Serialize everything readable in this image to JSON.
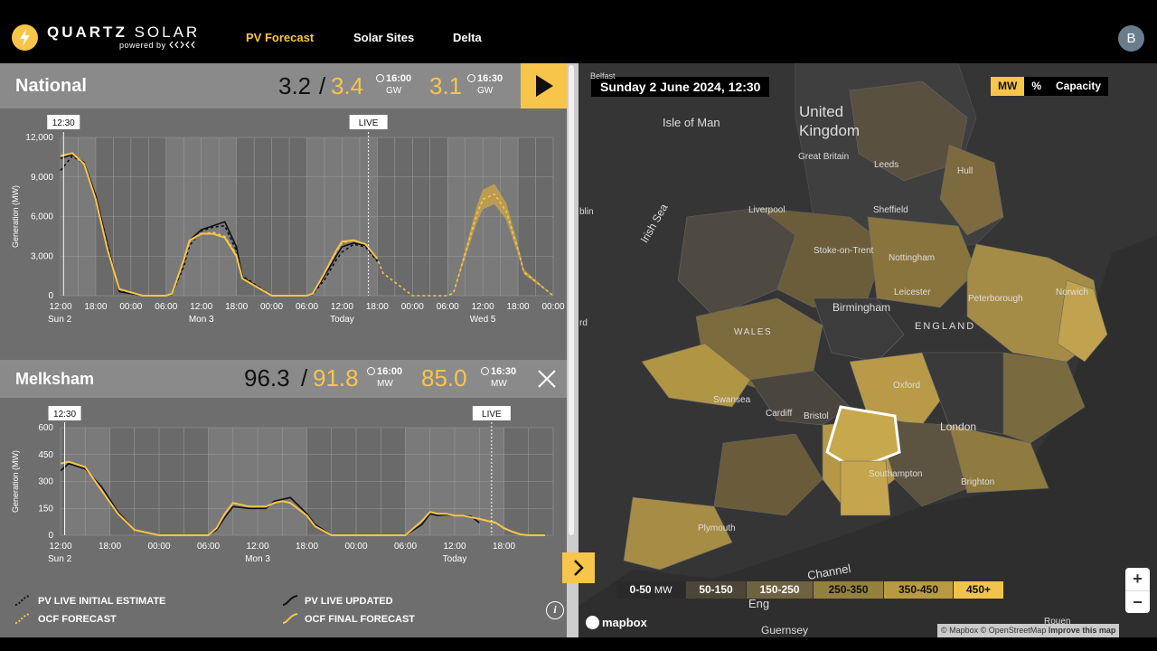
{
  "header": {
    "brand_bold": "QUARTZ",
    "brand_light": "SOLAR",
    "powered_by": "powered by",
    "nav": [
      "PV Forecast",
      "Solar Sites",
      "Delta"
    ],
    "active_nav": "PV Forecast",
    "avatar_initial": "B"
  },
  "national": {
    "title": "National",
    "actual": "3.2",
    "sep": "/",
    "forecast": "3.4",
    "forecast_time": "16:00",
    "forecast_unit": "GW",
    "next": "3.1",
    "next_time": "16:30",
    "next_unit": "GW",
    "marker_label": "12:30",
    "live_label": "LIVE",
    "ylabel": "Generation (MW)"
  },
  "melksham": {
    "title": "Melksham",
    "actual": "96.3",
    "sep": "/",
    "forecast": "91.8",
    "forecast_time": "16:00",
    "forecast_unit": "MW",
    "next": "85.0",
    "next_time": "16:30",
    "next_unit": "MW",
    "marker_label": "12:30",
    "live_label": "LIVE",
    "ylabel": "Generation (MW)"
  },
  "legend": {
    "initial": "PV LIVE INITIAL ESTIMATE",
    "updated": "PV LIVE UPDATED",
    "forecast": "OCF FORECAST",
    "final": "OCF FINAL FORECAST"
  },
  "map": {
    "date": "Sunday 2 June 2024, 12:30",
    "units": [
      "MW",
      "%",
      "Capacity"
    ],
    "active_unit": "MW",
    "labels": {
      "isle_of_man": "Isle of Man",
      "united_kingdom": "United Kingdom",
      "great_britain": "Great Britain",
      "leeds": "Leeds",
      "hull": "Hull",
      "liverpool": "Liverpool",
      "sheffield": "Sheffield",
      "irish_sea": "Irish Sea",
      "dublin": "blin",
      "belfast": "Belfast",
      "stoke": "Stoke-on-Trent",
      "nottingham": "Nottingham",
      "leicester": "Leicester",
      "peterborough": "Peterborough",
      "norwich": "Norwich",
      "birmingham": "Birmingham",
      "england": "ENGLAND",
      "wales": "WALES",
      "oxford": "Oxford",
      "swansea": "Swansea",
      "cardiff": "Cardiff",
      "bristol": "Bristol",
      "london": "London",
      "southampton": "Southampton",
      "brighton": "Brighton",
      "plymouth": "Plymouth",
      "channel": "Channel",
      "guernsey": "Guernsey",
      "rouen": "Rouen",
      "eng": "Eng",
      "rd": "rd"
    },
    "legend": [
      "0-50",
      "50-150",
      "150-250",
      "250-350",
      "350-450",
      "450+"
    ],
    "legend_unit": "MW",
    "zoom_in": "+",
    "zoom_out": "−",
    "mapbox": "mapbox",
    "attribution": "© Mapbox © OpenStreetMap",
    "improve": "Improve this map"
  },
  "chart_data": [
    {
      "type": "line",
      "name": "National",
      "ylabel": "Generation (MW)",
      "ylim": [
        0,
        12000
      ],
      "yticks": [
        "0",
        "3,000",
        "6,000",
        "9,000",
        "12,000"
      ],
      "x_tick_labels": [
        "12:00",
        "18:00",
        "00:00",
        "06:00",
        "12:00",
        "18:00",
        "00:00",
        "06:00",
        "12:00",
        "18:00",
        "00:00",
        "06:00",
        "12:00",
        "18:00",
        "00:00"
      ],
      "day_labels": [
        "Sun 2",
        "Mon 3",
        "Today",
        "Wed 5"
      ],
      "x_hours": [
        0,
        2,
        4,
        6,
        8,
        10,
        14,
        18,
        19,
        21,
        22,
        24,
        26,
        28,
        30,
        31,
        36,
        42,
        43,
        45,
        47,
        48,
        50,
        52,
        54,
        55,
        60,
        66,
        67,
        69,
        71,
        72,
        74,
        76,
        78,
        79,
        84
      ],
      "series": [
        {
          "name": "PV LIVE INITIAL ESTIMATE",
          "values": [
            9500,
            10600,
            10000,
            7500,
            3800,
            400,
            0,
            0,
            100,
            2200,
            3800,
            4900,
            5200,
            5300,
            3400,
            1500,
            0,
            0,
            100,
            1200,
            2700,
            3300,
            3900,
            3700,
            2600,
            null,
            null,
            null,
            null,
            null,
            null,
            null,
            null,
            null,
            null,
            null,
            null
          ]
        },
        {
          "name": "PV LIVE UPDATED",
          "values": [
            10400,
            10700,
            10100,
            7600,
            3900,
            300,
            0,
            0,
            100,
            2500,
            4200,
            5000,
            5300,
            5600,
            3700,
            1400,
            0,
            0,
            100,
            1500,
            3000,
            3700,
            4000,
            3800,
            2700,
            null,
            null,
            null,
            null,
            null,
            null,
            null,
            null,
            null,
            null,
            null,
            null
          ]
        },
        {
          "name": "OCF FORECAST",
          "values": [
            10600,
            10800,
            10000,
            7300,
            3600,
            500,
            0,
            0,
            150,
            2600,
            4100,
            4700,
            4800,
            4500,
            3100,
            1300,
            0,
            0,
            150,
            1700,
            3300,
            4000,
            4200,
            3900,
            2800,
            1700,
            0,
            0,
            200,
            3200,
            6200,
            7300,
            7700,
            6400,
            3500,
            1800,
            0
          ]
        },
        {
          "name": "OCF FINAL FORECAST",
          "values": [
            10600,
            10800,
            10000,
            7300,
            3500,
            500,
            0,
            0,
            150,
            2700,
            4200,
            4700,
            4700,
            4400,
            3000,
            1300,
            0,
            0,
            150,
            1700,
            3400,
            4100,
            4200,
            3900,
            2800,
            null,
            null,
            null,
            null,
            null,
            null,
            null,
            null,
            null,
            null,
            null,
            null
          ]
        }
      ]
    },
    {
      "type": "line",
      "name": "Melksham",
      "ylabel": "Generation (MW)",
      "ylim": [
        0,
        600
      ],
      "yticks": [
        "0",
        "150",
        "300",
        "450",
        "600"
      ],
      "x_tick_labels": [
        "12:00",
        "18:00",
        "00:00",
        "06:00",
        "12:00",
        "18:00",
        "00:00",
        "06:00",
        "12:00",
        "18:00"
      ],
      "day_labels": [
        "Sun 2",
        "Mon 3",
        "Today"
      ],
      "x_hours": [
        0,
        1,
        3,
        5,
        7,
        9,
        12,
        18,
        19,
        20,
        21,
        23,
        25,
        26,
        27,
        28,
        30,
        31,
        33,
        36,
        42,
        43,
        44,
        45,
        46,
        47,
        48,
        49,
        50,
        51,
        52,
        53,
        54,
        55,
        56,
        57,
        59
      ],
      "series": [
        {
          "name": "PV LIVE UPDATED",
          "values": [
            360,
            400,
            370,
            270,
            130,
            30,
            0,
            0,
            30,
            100,
            160,
            150,
            150,
            190,
            200,
            210,
            120,
            60,
            0,
            0,
            0,
            30,
            60,
            120,
            110,
            115,
            110,
            110,
            105,
            70,
            null,
            null,
            null,
            null,
            null,
            null,
            null
          ]
        },
        {
          "name": "OCF FINAL FORECAST",
          "values": [
            400,
            410,
            380,
            250,
            120,
            30,
            0,
            0,
            40,
            120,
            180,
            160,
            160,
            180,
            190,
            180,
            110,
            50,
            0,
            0,
            0,
            40,
            80,
            130,
            120,
            120,
            110,
            110,
            100,
            92,
            80,
            70,
            40,
            20,
            5,
            0,
            0
          ]
        }
      ]
    }
  ]
}
